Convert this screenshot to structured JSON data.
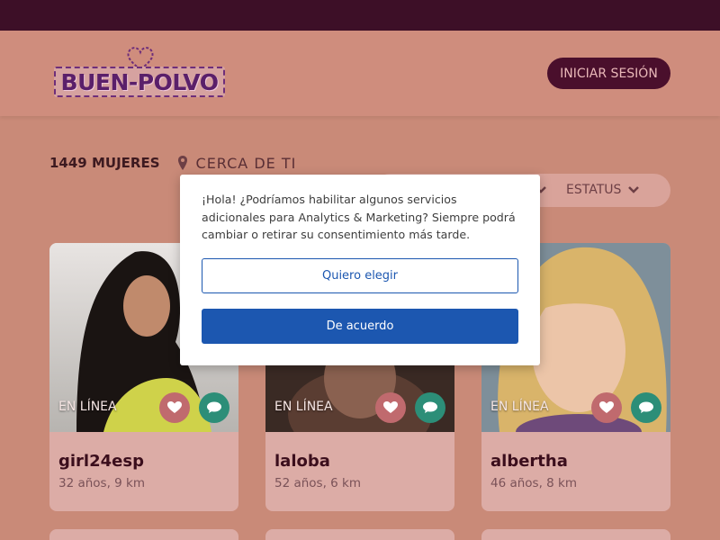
{
  "header": {
    "logo_text": "BUEN-POLVO",
    "login_label": "INICIAR SESIÓN"
  },
  "filters": {
    "count": "1449 MUJERES",
    "location": "CERCA DE TI",
    "status_label": "ESTATUS"
  },
  "cards": [
    {
      "name": "girl24esp",
      "meta": "32 años, 9 km",
      "status": "EN LÍNEA"
    },
    {
      "name": "laloba",
      "meta": "52 años, 6 km",
      "status": "EN LÍNEA"
    },
    {
      "name": "albertha",
      "meta": "46 años, 8 km",
      "status": "EN LÍNEA"
    }
  ],
  "consent": {
    "message": "¡Hola! ¿Podríamos habilitar algunos servicios adicionales para Analytics & Marketing? Siempre podrá cambiar o retirar su consentimiento más tarde.",
    "choose_label": "Quiero elegir",
    "agree_label": "De acuerdo"
  },
  "colors": {
    "topbar": "#3d0f27",
    "accent_button": "#4a0f2c",
    "consent_blue": "#1c57b0",
    "like_button": "#c06a6e",
    "chat_button": "#2c8e78"
  },
  "icons": [
    "heart-icon",
    "chat-icon",
    "location-pin-icon",
    "chevron-down-icon"
  ]
}
